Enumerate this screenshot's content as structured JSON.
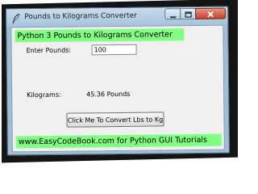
{
  "window": {
    "title": "Pounds to Kilograms Converter"
  },
  "header": {
    "heading": "Python 3 Pounds to Kilograms Converter"
  },
  "form": {
    "enter_label": "Enter Pounds:",
    "pounds_value": "100",
    "kilograms_label": "Kilograms:",
    "result_text": "45.36  Pounds",
    "convert_button_label": "Click Me To Convert Lbs to Kg"
  },
  "footer": {
    "text": "www.EasyCodeBook.com for Python GUI Tutorials"
  },
  "icons": {
    "app": "feather-icon",
    "minimize": "minimize-icon",
    "maximize": "maximize-icon",
    "close": "close-icon"
  },
  "colors": {
    "highlight": "#80ff80",
    "client_background": "#f0f0f0",
    "close_button": "#c7472f"
  }
}
